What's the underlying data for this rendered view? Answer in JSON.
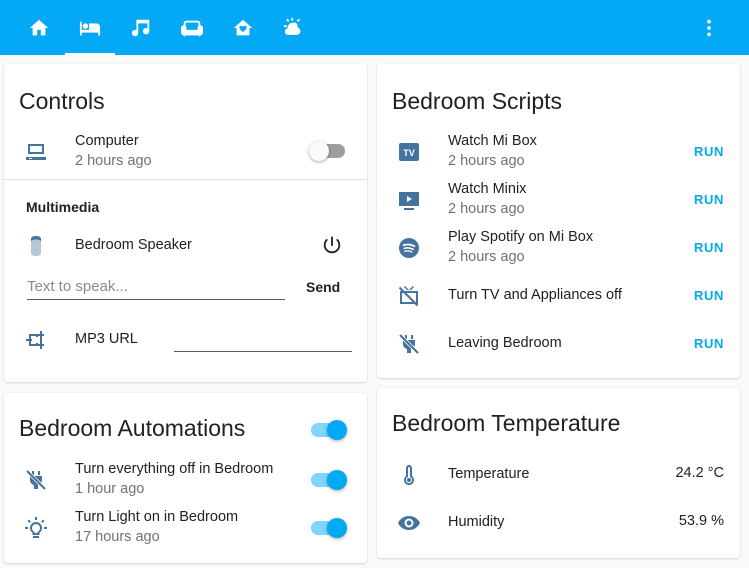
{
  "header": {
    "tabs": [
      {
        "icon": "home-icon",
        "active": false
      },
      {
        "icon": "bed-icon",
        "active": true
      },
      {
        "icon": "music-icon",
        "active": false
      },
      {
        "icon": "sofa-icon",
        "active": false
      },
      {
        "icon": "home-heart-icon",
        "active": false
      },
      {
        "icon": "weather-partly-cloudy-icon",
        "active": false
      }
    ],
    "menu_icon": "dots-vertical-icon",
    "color": "#03a9f4"
  },
  "controls": {
    "title": "Controls",
    "computer": {
      "name": "Computer",
      "secondary": "2 hours ago",
      "state": "off",
      "icon": "computer-icon"
    },
    "multimedia_label": "Multimedia",
    "speaker": {
      "name": "Bedroom Speaker",
      "icon": "speaker-icon",
      "action_icon": "power-icon"
    },
    "tts": {
      "placeholder": "Text to speak...",
      "value": "",
      "send_label": "Send"
    },
    "mp3": {
      "name": "MP3 URL",
      "icon": "audio-input-icon",
      "value": ""
    }
  },
  "scripts": {
    "title": "Bedroom Scripts",
    "items": [
      {
        "name": "Watch Mi Box",
        "secondary": "2 hours ago",
        "icon": "tv-box-icon",
        "action": "RUN"
      },
      {
        "name": "Watch Minix",
        "secondary": "2 hours ago",
        "icon": "youtube-tv-icon",
        "action": "RUN"
      },
      {
        "name": "Play Spotify on Mi Box",
        "secondary": "2 hours ago",
        "icon": "spotify-icon",
        "action": "RUN"
      },
      {
        "name": "Turn TV and Appliances off",
        "icon": "tv-off-icon",
        "action": "RUN"
      },
      {
        "name": "Leaving Bedroom",
        "icon": "power-plug-off-icon",
        "action": "RUN"
      }
    ]
  },
  "automations": {
    "title": "Bedroom Automations",
    "master_state": "on",
    "items": [
      {
        "name": "Turn everything off in Bedroom",
        "secondary": "1 hour ago",
        "icon": "power-plug-off-icon",
        "state": "on"
      },
      {
        "name": "Turn Light on in Bedroom",
        "secondary": "17 hours ago",
        "icon": "lightbulb-on-icon",
        "state": "on"
      }
    ]
  },
  "temperature": {
    "title": "Bedroom Temperature",
    "items": [
      {
        "name": "Temperature",
        "value": "24.2 °C",
        "icon": "thermometer-icon"
      },
      {
        "name": "Humidity",
        "value": "53.9 %",
        "icon": "eye-icon"
      }
    ]
  },
  "colors": {
    "accent": "#03a9f4",
    "icon": "#44739e",
    "secondary_text": "#727272"
  }
}
